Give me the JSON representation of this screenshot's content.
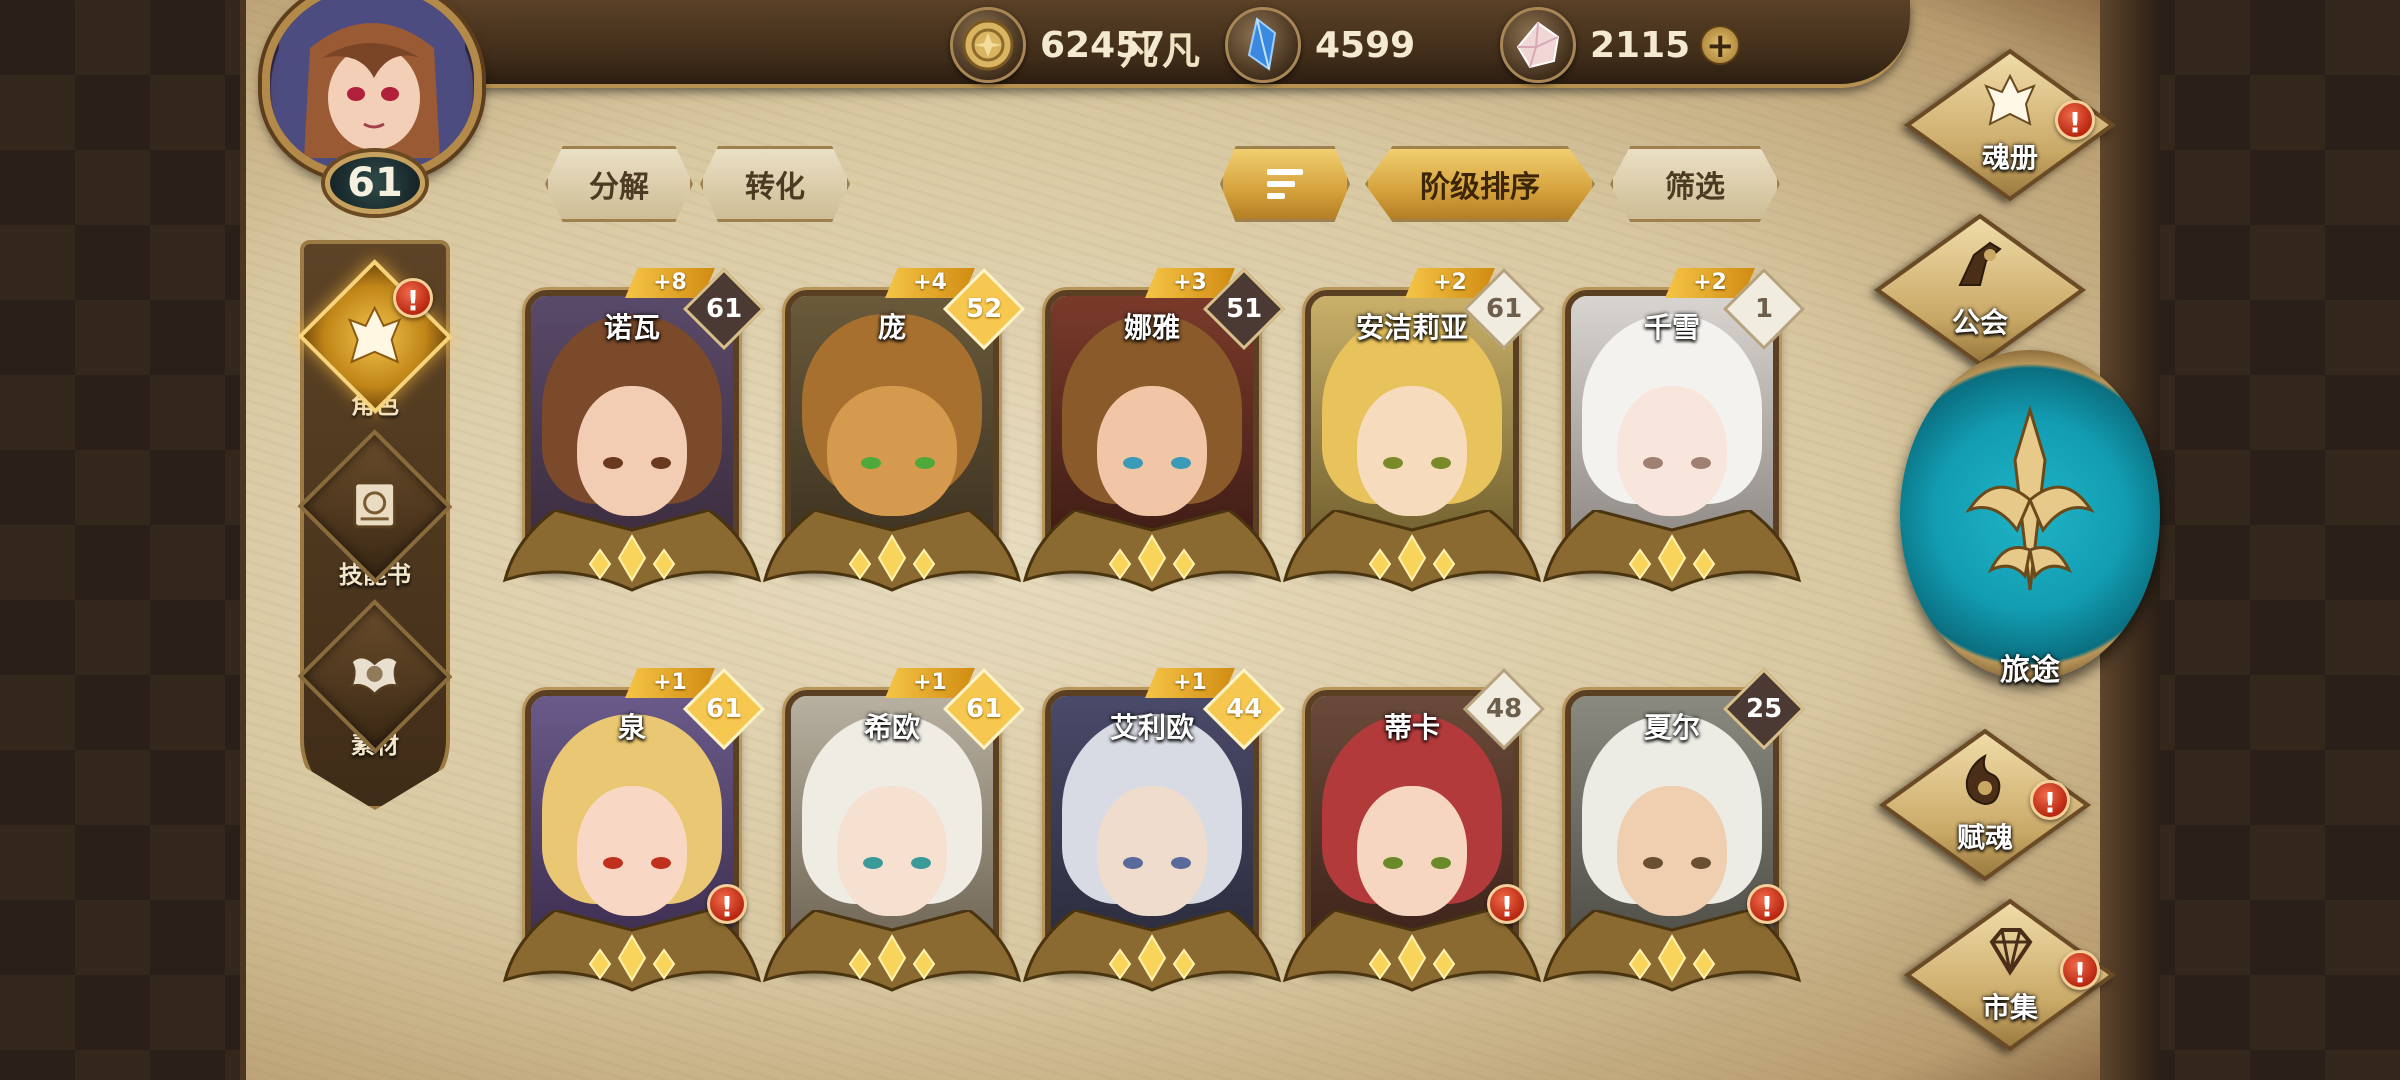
{
  "player": {
    "name": "凡凡",
    "level": "61"
  },
  "currencies": [
    {
      "icon": "gold-coin-icon",
      "value": "62457"
    },
    {
      "icon": "blue-crystal-icon",
      "value": "4599"
    },
    {
      "icon": "pink-gem-icon",
      "value": "2115",
      "plus": "+"
    }
  ],
  "sidebar": {
    "items": [
      {
        "label": "角色",
        "icon": "character-icon",
        "active": true,
        "alert": "!"
      },
      {
        "label": "技能书",
        "icon": "skill-book-icon",
        "active": false
      },
      {
        "label": "素材",
        "icon": "material-icon",
        "active": false
      }
    ]
  },
  "toolbar": {
    "decompose_label": "分解",
    "convert_label": "转化",
    "sort_label": "阶级排序",
    "filter_label": "筛选"
  },
  "heroes": [
    {
      "name": "诺瓦",
      "plus": "+8",
      "level": "61",
      "badge": "dark",
      "alert": ""
    },
    {
      "name": "庞",
      "plus": "+4",
      "level": "52",
      "badge": "gold",
      "alert": ""
    },
    {
      "name": "娜雅",
      "plus": "+3",
      "level": "51",
      "badge": "dark",
      "alert": ""
    },
    {
      "name": "安洁莉亚",
      "plus": "+2",
      "level": "61",
      "badge": "light",
      "alert": ""
    },
    {
      "name": "千雪",
      "plus": "+2",
      "level": "1",
      "badge": "light",
      "alert": ""
    },
    {
      "name": "泉",
      "plus": "+1",
      "level": "61",
      "badge": "gold",
      "alert": "!"
    },
    {
      "name": "希欧",
      "plus": "+1",
      "level": "61",
      "badge": "gold",
      "alert": ""
    },
    {
      "name": "艾利欧",
      "plus": "+1",
      "level": "44",
      "badge": "gold",
      "alert": ""
    },
    {
      "name": "蒂卡",
      "plus": "",
      "level": "48",
      "badge": "light",
      "alert": "!"
    },
    {
      "name": "夏尔",
      "plus": "",
      "level": "25",
      "badge": "dark",
      "alert": "!"
    }
  ],
  "rightnav": {
    "soulbook_label": "魂册",
    "guild_label": "公会",
    "journey_label": "旅途",
    "endow_label": "赋魂",
    "market_label": "市集",
    "alert": "!"
  },
  "colors": {
    "accent_gold": "#f3c34d",
    "alert_red": "#d23a1c",
    "parchment": "#e1d3b1",
    "journey_teal": "#1fb3c6"
  }
}
